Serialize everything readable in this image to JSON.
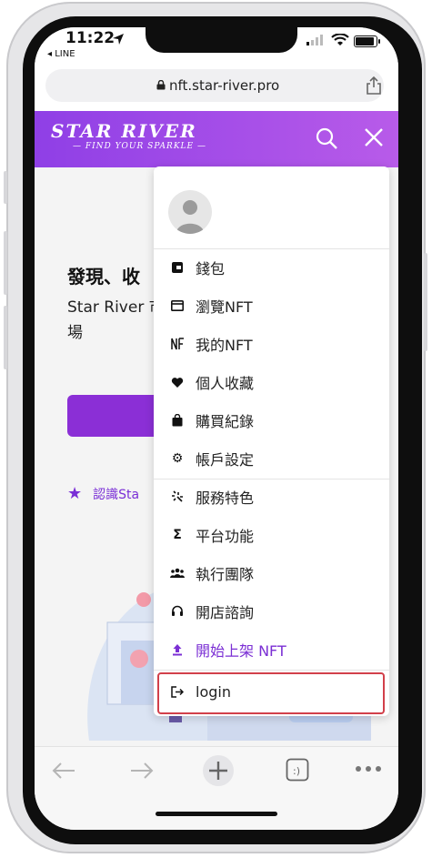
{
  "status": {
    "time": "11:22",
    "back_app": "◂ LINE"
  },
  "browser": {
    "url": "nft.star-river.pro"
  },
  "header": {
    "logo_main": "STAR RIVER",
    "logo_sub": "— FIND YOUR SPARKLE —"
  },
  "hero": {
    "title": "發現、收",
    "subtitle": "Star River 市場",
    "link": "認識Sta"
  },
  "menu": {
    "items": [
      {
        "label": "錢包",
        "icon": "wallet-icon"
      },
      {
        "label": "瀏覽NFT",
        "icon": "browse-card-icon"
      },
      {
        "label": "我的NFT",
        "icon": "nft-icon"
      },
      {
        "label": "個人收藏",
        "icon": "heart-icon"
      },
      {
        "label": "購買紀錄",
        "icon": "shopping-bag-icon"
      },
      {
        "label": "帳戶設定",
        "icon": "gear-icon"
      }
    ],
    "items2": [
      {
        "label": "服務特色",
        "icon": "sparkle-icon"
      },
      {
        "label": "平台功能",
        "icon": "sigma-icon"
      },
      {
        "label": "執行團隊",
        "icon": "team-icon"
      },
      {
        "label": "開店諮詢",
        "icon": "headset-icon"
      },
      {
        "label": "開始上架 NFT",
        "icon": "upload-icon"
      }
    ],
    "login": "login"
  },
  "colors": {
    "brand_purple": "#8f3fe6",
    "highlight_red": "#d2404a"
  }
}
